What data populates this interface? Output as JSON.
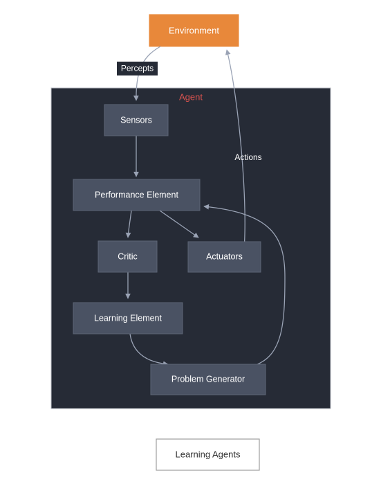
{
  "diagram": {
    "title": "Learning Agents",
    "environment": {
      "label": "Environment",
      "fill": "#e8883a",
      "text_color": "#ffffff"
    },
    "agent": {
      "label": "Agent",
      "fill": "#262b36",
      "label_color": "#d9534f"
    },
    "nodes": [
      {
        "id": "sensors",
        "label": "Sensors",
        "fill": "#4a5263"
      },
      {
        "id": "performance-element",
        "label": "Performance Element",
        "fill": "#4a5263"
      },
      {
        "id": "critic",
        "label": "Critic",
        "fill": "#4a5263"
      },
      {
        "id": "actuators",
        "label": "Actuators",
        "fill": "#4a5263"
      },
      {
        "id": "learning-element",
        "label": "Learning Element",
        "fill": "#4a5263"
      },
      {
        "id": "problem-generator",
        "label": "Problem Generator",
        "fill": "#4a5263"
      }
    ],
    "edge_labels": [
      {
        "id": "percepts",
        "label": "Percepts",
        "boxed": true,
        "box_fill": "#262b36",
        "text_color": "#ffffff"
      },
      {
        "id": "actions",
        "label": "Actions",
        "boxed": false,
        "text_color": "#ffffff"
      }
    ],
    "edges": [
      {
        "from": "environment",
        "to": "sensors",
        "label": "Percepts"
      },
      {
        "from": "sensors",
        "to": "performance-element",
        "label": ""
      },
      {
        "from": "performance-element",
        "to": "critic",
        "label": ""
      },
      {
        "from": "performance-element",
        "to": "actuators",
        "label": ""
      },
      {
        "from": "actuators",
        "to": "environment",
        "label": "Actions"
      },
      {
        "from": "critic",
        "to": "learning-element",
        "label": ""
      },
      {
        "from": "learning-element",
        "to": "problem-generator",
        "label": ""
      },
      {
        "from": "problem-generator",
        "to": "performance-element",
        "label": ""
      }
    ],
    "caption": {
      "label": "Learning Agents",
      "fill": "#ffffff",
      "border": "#9e9e9e",
      "text_color": "#333333"
    },
    "edge_color": "#9aa3b5",
    "background": "#ffffff"
  }
}
